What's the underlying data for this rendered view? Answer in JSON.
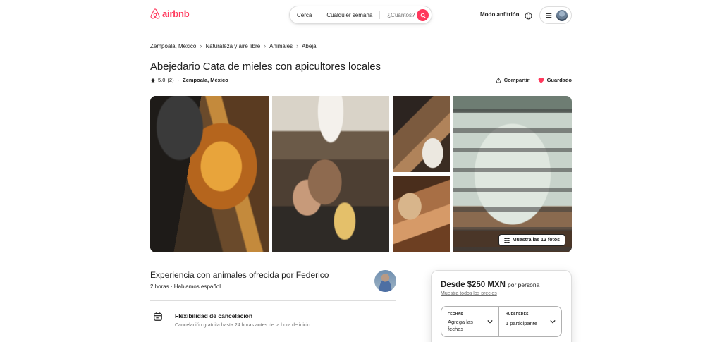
{
  "header": {
    "logo_text": "airbnb",
    "search": {
      "location": "Cerca",
      "dates": "Cualquier semana",
      "guests_placeholder": "¿Cuántos?"
    },
    "host_mode": "Modo anfitrión"
  },
  "breadcrumb": [
    "Zempoala, México",
    "Naturaleza y aire libre",
    "Animales",
    "Abeja"
  ],
  "listing": {
    "title": "Abejedario Cata de mieles con apicultores locales",
    "rating": "5.0",
    "review_count": "(2)",
    "location": "Zempoala, México",
    "share": "Compartir",
    "save": "Guardado",
    "show_photos": "Muestra las 12 fotos"
  },
  "host": {
    "title": "Experiencia con animales ofrecida por Federico",
    "subtitle": "2 horas · Hablamos español"
  },
  "cancellation": {
    "title": "Flexibilidad de cancelación",
    "description": "Cancelación gratuita hasta 24 horas antes de la hora de inicio."
  },
  "booking": {
    "price_prefix": "Desde",
    "price": "$250 MXN",
    "per": "por persona",
    "show_prices": "Muestra todos los precios",
    "dates_label": "FECHAS",
    "dates_value": "Agrega las fechas",
    "guests_label": "HUÉSPEDES",
    "guests_value": "1 participante"
  },
  "colors": {
    "brand": "#ff385c",
    "text": "#222222",
    "muted": "#717171",
    "border": "#dddddd"
  }
}
